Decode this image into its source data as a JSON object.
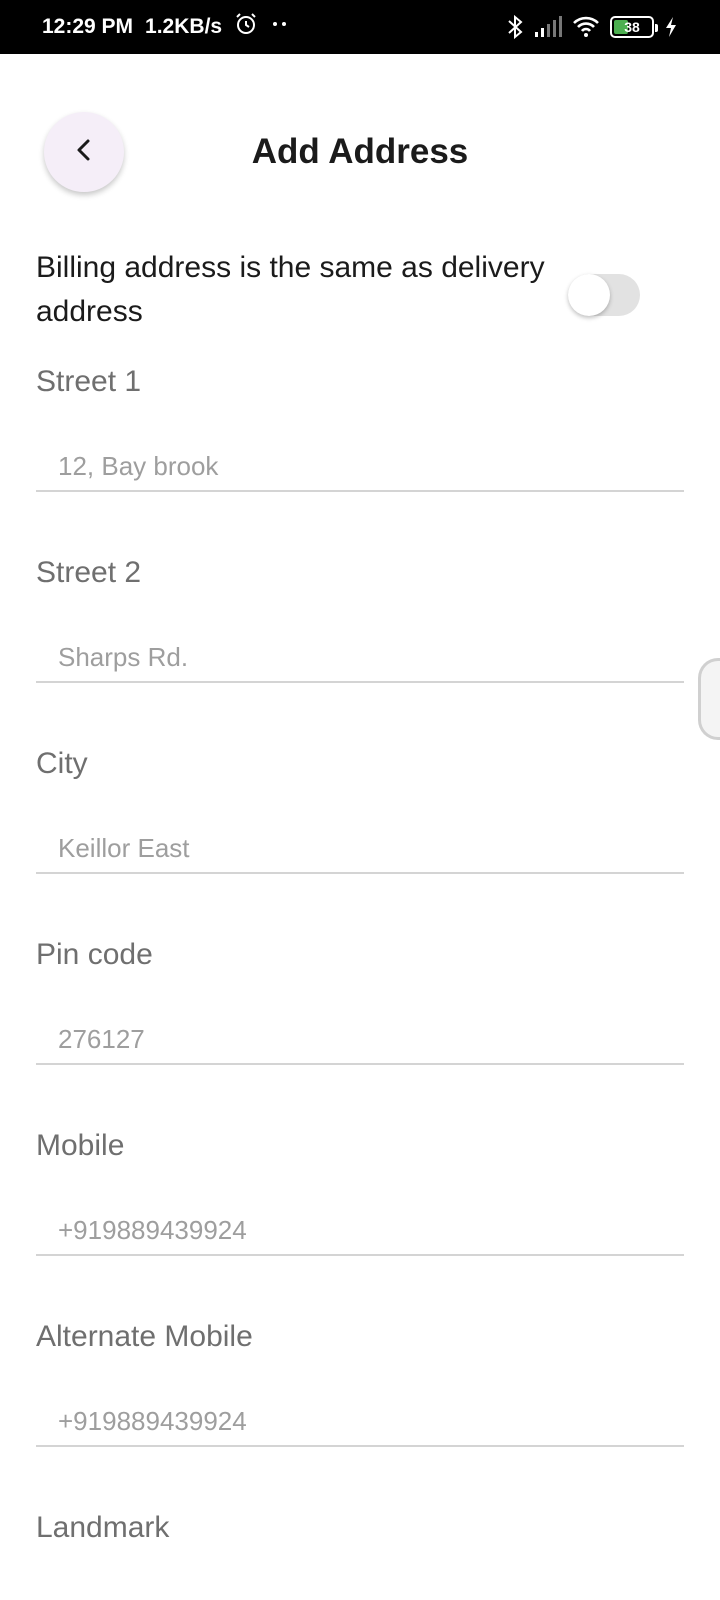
{
  "status_bar": {
    "time": "12:29 PM",
    "speed": "1.2KB/s",
    "battery_level": "38",
    "icons": [
      "alarm-icon",
      "more-dots-icon",
      "bluetooth-icon",
      "signal-icon",
      "wifi-icon",
      "battery-icon",
      "charging-icon"
    ]
  },
  "header": {
    "title": "Add Address",
    "back_icon": "chevron-left-icon"
  },
  "billing": {
    "label": "Billing address is the same as delivery address",
    "toggle_on": false
  },
  "fields": [
    {
      "label": "Street 1",
      "placeholder": "12, Bay brook"
    },
    {
      "label": "Street 2",
      "placeholder": "Sharps Rd."
    },
    {
      "label": "City",
      "placeholder": "Keillor East"
    },
    {
      "label": "Pin code",
      "placeholder": "276127"
    },
    {
      "label": "Mobile",
      "placeholder": "+919889439924"
    },
    {
      "label": "Alternate Mobile",
      "placeholder": "+919889439924"
    },
    {
      "label": "Landmark",
      "placeholder": ""
    }
  ],
  "colors": {
    "accent_back_button": "#f5eef8",
    "battery_fill": "#4caf50",
    "toggle_track": "#e2e2e2"
  }
}
